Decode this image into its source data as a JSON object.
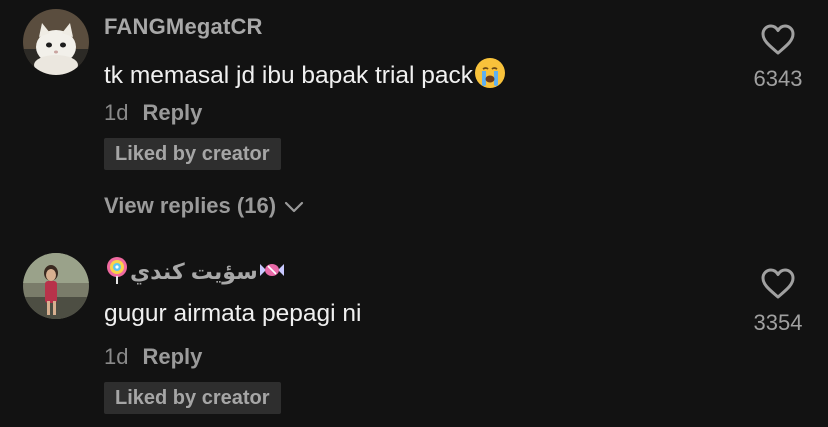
{
  "comments": [
    {
      "username": "FANGMegatCR",
      "text": "tk memasal jd ibu bapak trial pack",
      "emoji": "crying-face",
      "time": "1d",
      "reply_label": "Reply",
      "liked_label": "Liked by creator",
      "view_replies": "View replies (16)",
      "likes": "6343"
    },
    {
      "username": "سؤيت كندي",
      "text": "gugur airmata pepagi ni",
      "time": "1d",
      "reply_label": "Reply",
      "liked_label": "Liked by creator",
      "likes": "3354"
    }
  ],
  "colors": {
    "background": "#121212",
    "username": "#a8a8a8",
    "text": "#f0f0f0",
    "muted": "#8a8a8a",
    "badge_bg": "#2e2e2e"
  }
}
